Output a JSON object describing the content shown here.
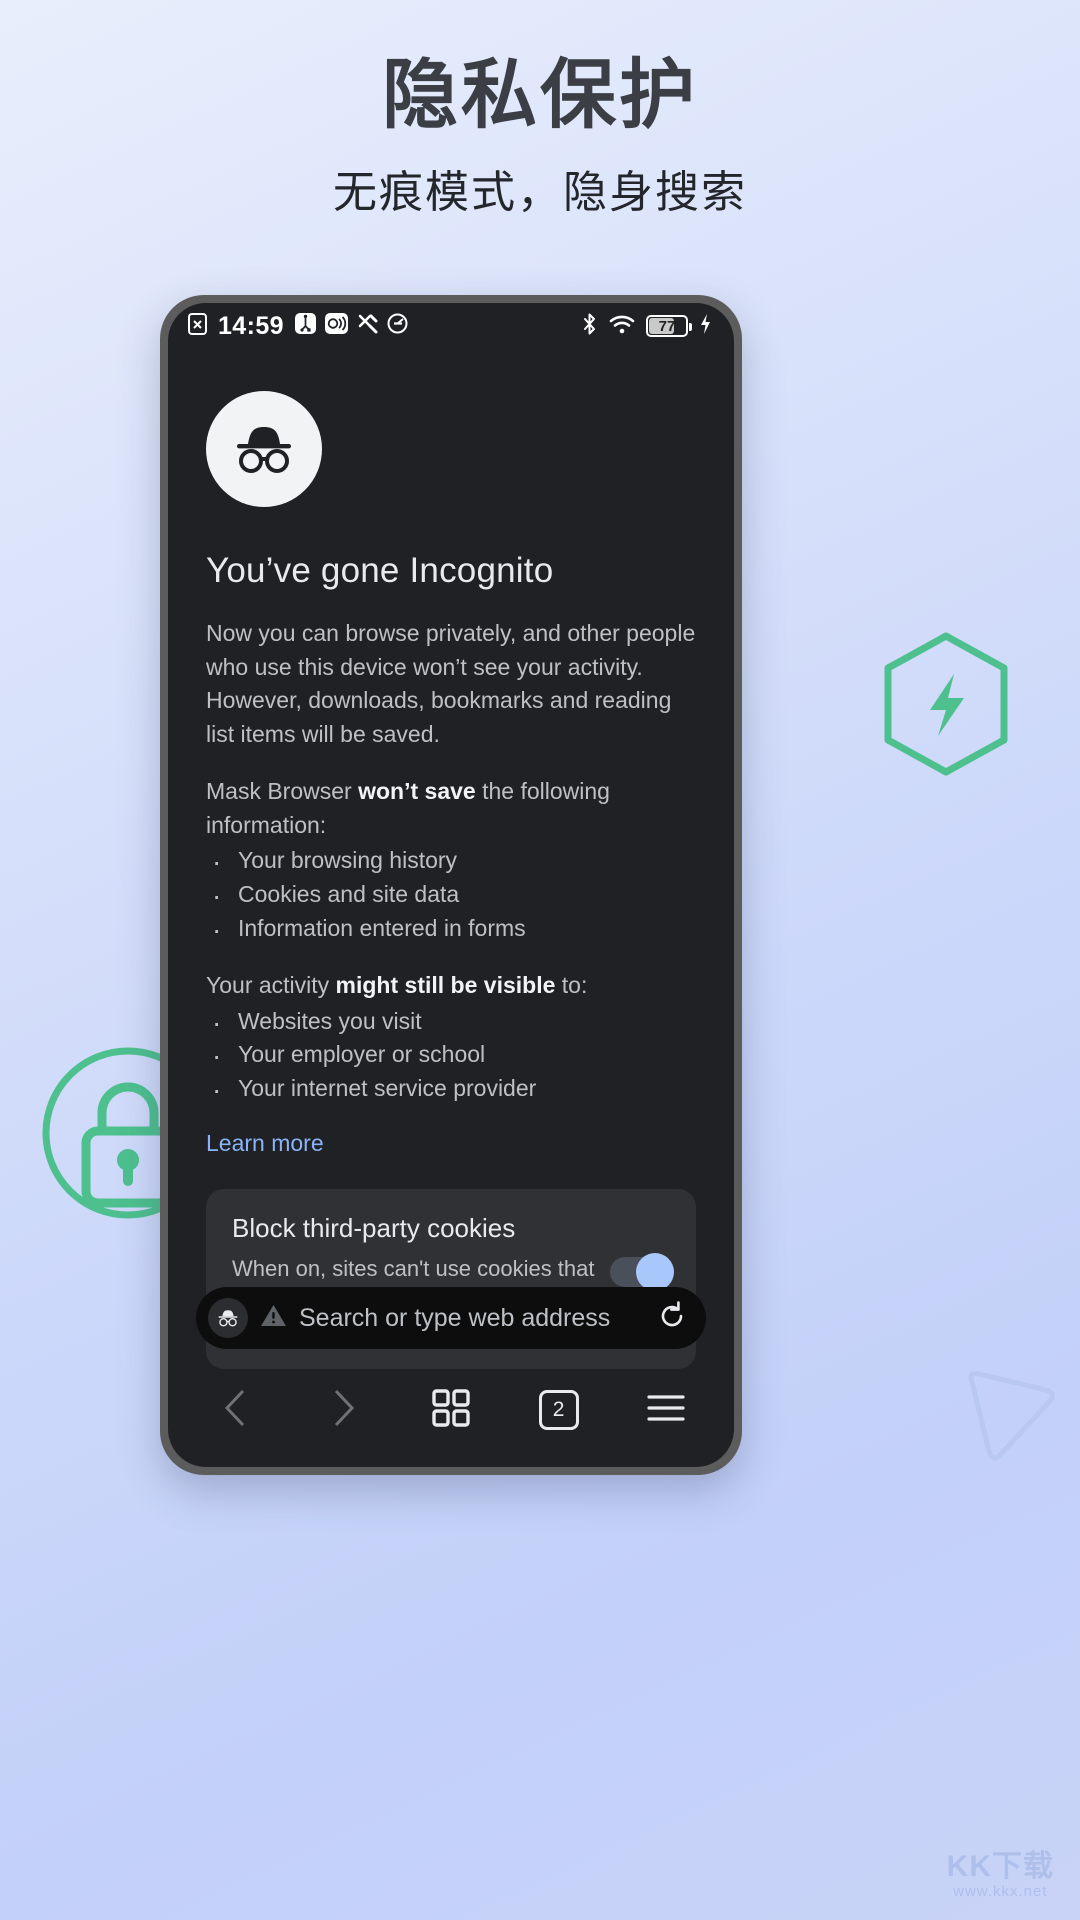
{
  "promo": {
    "title": "隐私保护",
    "subtitle": "无痕模式，隐身搜索"
  },
  "colors": {
    "accent_green": "#4DC08E",
    "toggle_on": "#a8c7fa",
    "link_blue": "#8ab4f8",
    "screen_bg": "#202124",
    "card_bg": "#303134"
  },
  "status_bar": {
    "time": "14:59",
    "battery_percent": "77",
    "left_icons": [
      "sim-card-off-icon",
      "usb-debug-icon",
      "sound-mode-icon",
      "developer-tools-icon",
      "do-not-disturb-icon"
    ],
    "right_icons": [
      "bluetooth-icon",
      "wifi-icon",
      "battery-icon",
      "charging-bolt-icon"
    ]
  },
  "incognito": {
    "heading": "You’ve gone Incognito",
    "intro": "Now you can browse privately, and other people who use this device won’t see your activity. However, downloads, bookmarks and reading list items will be saved.",
    "wont_save_prefix": "Mask Browser ",
    "wont_save_bold": "won’t save",
    "wont_save_suffix": " the following information:",
    "wont_save_items": [
      "Your browsing history",
      "Cookies and site data",
      "Information entered in forms"
    ],
    "visible_prefix": "Your activity ",
    "visible_bold": "might still be visible",
    "visible_suffix": " to:",
    "visible_items": [
      "Websites you visit",
      "Your employer or school",
      "Your internet service provider"
    ],
    "learn_more": "Learn more"
  },
  "cookie_card": {
    "title": "Block third-party cookies",
    "description": "When on, sites can't use cookies that track you across the web. Features on some sites may break.",
    "toggle_state": "on"
  },
  "omnibox": {
    "placeholder": "Search or type web address",
    "incognito_icon": "incognito-hat-icon",
    "warning_icon": "warning-triangle-icon",
    "reload_icon": "reload-icon"
  },
  "bottom_nav": {
    "back_icon": "chevron-left-icon",
    "forward_icon": "chevron-right-icon",
    "apps_icon": "grid-apps-icon",
    "tab_count": "2",
    "menu_icon": "hamburger-menu-icon"
  },
  "decorations": {
    "shield_icon": "shield-bolt-icon",
    "lock_icon": "lock-circle-icon",
    "triangle_icon": "rounded-triangle-icon"
  },
  "watermark": {
    "main": "KK下载",
    "sub": "www.kkx.net"
  }
}
